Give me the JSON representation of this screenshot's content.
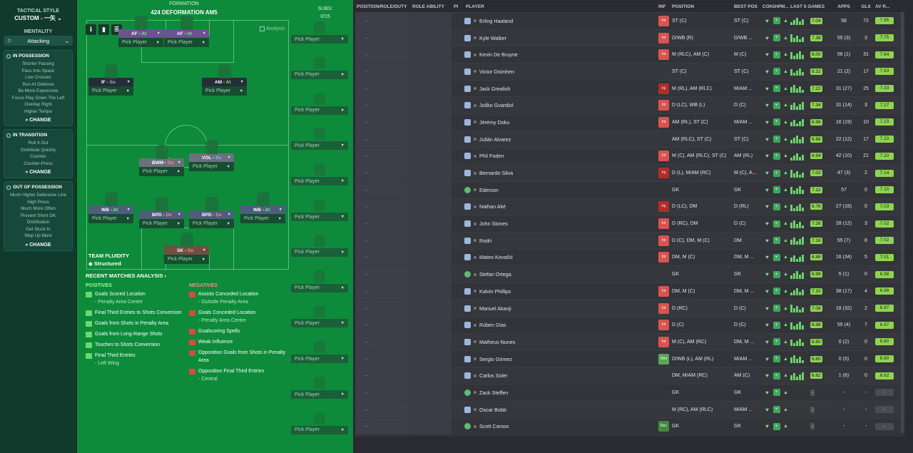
{
  "sidebar": {
    "header": "TACTICAL STYLE",
    "style_name": "CUSTOM - 一矢",
    "mentality_label": "MENTALITY",
    "mentality_value": "Attacking",
    "blocks": [
      {
        "title": "IN POSSESSION",
        "lines": [
          "Shorter Passing",
          "Pass Into Space",
          "Low Crosses",
          "Run At Defence",
          "Be More Expressive",
          "Focus Play Down The Left",
          "Overlap Right",
          "Higher Tempo"
        ],
        "change": "CHANGE"
      },
      {
        "title": "IN TRANSITION",
        "lines": [
          "Roll It Out",
          "Distribute Quickly",
          "Counter",
          "Counter-Press"
        ],
        "change": "CHANGE"
      },
      {
        "title": "OUT OF POSSESSION",
        "lines": [
          "Much Higher Defensive Line",
          "High Press",
          "Much More Often",
          "Prevent Short GK",
          "Distribution",
          "Get Stuck In",
          "Step Up More"
        ],
        "change": "CHANGE"
      }
    ]
  },
  "pitch": {
    "formation_label": "FORMATION",
    "formation": "424 DEFORMATION AM5",
    "analysis_label": "Analysis",
    "subs_label": "SUBS:",
    "subs_count": "0/15",
    "pick_label": "Pick Player",
    "team_fluidity_label": "TEAM FLUIDITY",
    "team_fluidity": "Structured",
    "players": [
      {
        "role": "AF",
        "duty": "At"
      },
      {
        "role": "AF",
        "duty": "At"
      },
      {
        "role": "IF",
        "duty": "Su"
      },
      {
        "role": "AM",
        "duty": "At"
      },
      {
        "role": "BWM",
        "duty": "De"
      },
      {
        "role": "VOL",
        "duty": "Su"
      },
      {
        "role": "WB",
        "duty": "At"
      },
      {
        "role": "BPD",
        "duty": "De"
      },
      {
        "role": "BPD",
        "duty": "De"
      },
      {
        "role": "WB",
        "duty": "At"
      },
      {
        "role": "SK",
        "duty": "De"
      }
    ],
    "recent_title": "RECENT MATCHES ANALYSIS ›",
    "positives_label": "POSITIVES",
    "negatives_label": "NEGATIVES",
    "positives": [
      {
        "title": "Goals Scored Location",
        "sub": "- Penalty Area Centre"
      },
      {
        "title": "Final Third Entries to Shots Conversion",
        "sub": ""
      },
      {
        "title": "Goals from Shots in Penalty Area",
        "sub": ""
      },
      {
        "title": "Goals from Long-Range Shots",
        "sub": ""
      },
      {
        "title": "Touches to Shots Conversion",
        "sub": ""
      },
      {
        "title": "Final Third Entries",
        "sub": "- Left Wing"
      }
    ],
    "negatives": [
      {
        "title": "Assists Conceded Location",
        "sub": "- Outside Penalty Area"
      },
      {
        "title": "Goals Conceded Location",
        "sub": "- Penalty Area Centre"
      },
      {
        "title": "Goalscoring Spells",
        "sub": ""
      },
      {
        "title": "Weak Influence",
        "sub": ""
      },
      {
        "title": "Opposition Goals from Shots in Penalty Area",
        "sub": ""
      },
      {
        "title": "Opposition Final Third Entries",
        "sub": "- Central"
      }
    ]
  },
  "squad": {
    "headers": {
      "position": "POSITION/ROLE/DUTY",
      "role_ability": "ROLE ABILITY",
      "pi": "PI",
      "player": "PLAYER",
      "inf": "INF",
      "pos": "POSITION",
      "best": "BEST POS",
      "con": "CON",
      "shp": "SHP",
      "m": "M...",
      "last5": "LAST 5 GAMES",
      "apps": "APPS",
      "gls": "GLS",
      "avr": "AV R..."
    },
    "rows": [
      {
        "name": "Erling Haaland",
        "inf": "Int",
        "pos": "ST (C)",
        "best": "ST (C)",
        "last5": "7.04",
        "apps": "58",
        "gls": "72",
        "avr": "7.95"
      },
      {
        "name": "Kyle Walker",
        "inf": "Int",
        "pos": "D/WB (R)",
        "best": "D/WB ...",
        "last5": "7.38",
        "apps": "55 (3)",
        "gls": "3",
        "avr": "7.75"
      },
      {
        "name": "Kevin De Bruyne",
        "inf": "Int",
        "pos": "M (RLC), AM (C)",
        "best": "M (C)",
        "last5": "8.00",
        "apps": "56 (1)",
        "gls": "31",
        "avr": "7.64"
      },
      {
        "name": "Victor Osimhen",
        "inf": "",
        "pos": "ST (C)",
        "best": "ST (C)",
        "last5": "8.22",
        "apps": "21 (2)",
        "gls": "17",
        "avr": "7.63"
      },
      {
        "name": "Jack Grealish",
        "inf": "Inj",
        "pos": "M (RL), AM (RLC)",
        "best": "M/AM ...",
        "last5": "7.22",
        "apps": "31 (27)",
        "gls": "25",
        "avr": "7.33"
      },
      {
        "name": "Joško Gvardiol",
        "inf": "Int",
        "pos": "D (LC), WB (L)",
        "best": "D (C)",
        "last5": "7.34",
        "apps": "31 (14)",
        "gls": "3",
        "avr": "7.27"
      },
      {
        "name": "Jérémy Doku",
        "inf": "Int",
        "pos": "AM (RL), ST (C)",
        "best": "M/AM ...",
        "last5": "6.96",
        "apps": "16 (19)",
        "gls": "10",
        "avr": "7.23"
      },
      {
        "name": "Julián Alvarez",
        "inf": "",
        "pos": "AM (RLC), ST (C)",
        "best": "ST (C)",
        "last5": "6.68",
        "apps": "22 (12)",
        "gls": "17",
        "avr": "7.23"
      },
      {
        "name": "Phil Foden",
        "inf": "Int",
        "pos": "M (C), AM (RLC), ST (C)",
        "best": "AM (RL)",
        "last5": "6.94",
        "apps": "42 (10)",
        "gls": "21",
        "avr": "7.20"
      },
      {
        "name": "Bernardo Silva",
        "inf": "Inj",
        "pos": "D (L), M/AM (RC)",
        "best": "M (C), A...",
        "last5": "7.02",
        "apps": "47 (3)",
        "gls": "2",
        "avr": "7.14"
      },
      {
        "name": "Ederson",
        "inf": "",
        "pos": "GK",
        "best": "GK",
        "last5": "7.12",
        "apps": "57",
        "gls": "0",
        "avr": "7.10"
      },
      {
        "name": "Nathan Aké",
        "inf": "Inj",
        "pos": "D (LC), DM",
        "best": "D (RL)",
        "last5": "6.76",
        "apps": "27 (18)",
        "gls": "0",
        "avr": "7.03"
      },
      {
        "name": "John Stones",
        "inf": "Int",
        "pos": "D (RC), DM",
        "best": "D (C)",
        "last5": "7.26",
        "apps": "28 (12)",
        "gls": "3",
        "avr": "7.02"
      },
      {
        "name": "Rodri",
        "inf": "Int",
        "pos": "D (C), DM, M (C)",
        "best": "DM",
        "last5": "7.16",
        "apps": "55 (7)",
        "gls": "8",
        "avr": "7.02"
      },
      {
        "name": "Mateo Kovačić",
        "inf": "Int",
        "pos": "DM, M (C)",
        "best": "DM, M ...",
        "last5": "6.88",
        "apps": "16 (34)",
        "gls": "5",
        "avr": "7.01"
      },
      {
        "name": "Stefan Ortega",
        "inf": "",
        "pos": "GK",
        "best": "GK",
        "last5": "6.98",
        "apps": "5 (1)",
        "gls": "0",
        "avr": "6.98"
      },
      {
        "name": "Kalvin Phillips",
        "inf": "Int",
        "pos": "DM, M (C)",
        "best": "DM, M ...",
        "last5": "7.10",
        "apps": "38 (17)",
        "gls": "4",
        "avr": "6.98"
      },
      {
        "name": "Manuel Akanji",
        "inf": "Int",
        "pos": "D (RC)",
        "best": "D (C)",
        "last5": "7.08",
        "apps": "18 (32)",
        "gls": "2",
        "avr": "6.97"
      },
      {
        "name": "Rúben Dias",
        "inf": "Int",
        "pos": "D (C)",
        "best": "D (C)",
        "last5": "6.98",
        "apps": "55 (4)",
        "gls": "7",
        "avr": "6.97"
      },
      {
        "name": "Matheus Nunes",
        "inf": "Int",
        "pos": "M (C), AM (RC)",
        "best": "DM, M ...",
        "last5": "6.80",
        "apps": "0 (2)",
        "gls": "0",
        "avr": "6.80"
      },
      {
        "name": "Sergio Gómez",
        "inf": "Wnt",
        "pos": "D/WB (L), AM (RL)",
        "best": "M/AM ...",
        "last5": "6.80",
        "apps": "0 (5)",
        "gls": "0",
        "avr": "6.80"
      },
      {
        "name": "Carlos Soler",
        "inf": "",
        "pos": "DM, M/AM (RC)",
        "best": "AM (C)",
        "last5": "6.62",
        "apps": "1 (6)",
        "gls": "0",
        "avr": "6.62"
      },
      {
        "name": "Zack Steffen",
        "inf": "",
        "pos": "GK",
        "best": "GK",
        "last5": "-",
        "apps": "-",
        "gls": "-",
        "avr": "-"
      },
      {
        "name": "Oscar Bobb",
        "inf": "",
        "pos": "M (RC), AM (RLC)",
        "best": "M/AM ...",
        "last5": "-",
        "apps": "-",
        "gls": "-",
        "avr": "-"
      },
      {
        "name": "Scott Carson",
        "inf": "Rec",
        "pos": "GK",
        "best": "GK",
        "last5": "-",
        "apps": "-",
        "gls": "-",
        "avr": "-"
      }
    ]
  }
}
